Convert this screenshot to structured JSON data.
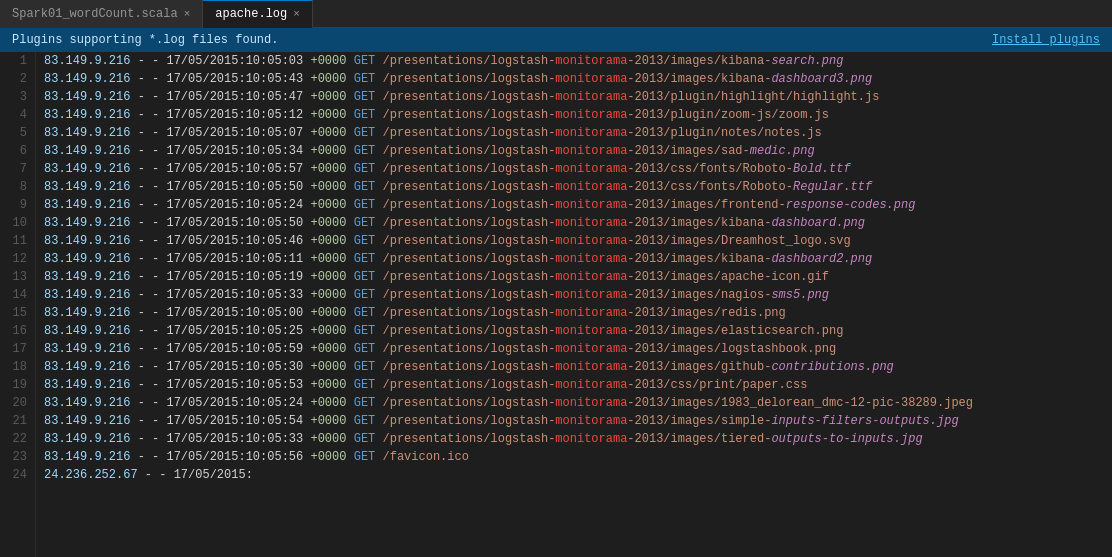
{
  "tabs": [
    {
      "id": "spark",
      "label": "Spark01_wordCount.scala",
      "active": false,
      "closeable": true
    },
    {
      "id": "apache",
      "label": "apache.log",
      "active": true,
      "closeable": true
    }
  ],
  "notification": {
    "message": "Plugins supporting *.log files found.",
    "install_label": "Install plugins"
  },
  "log_lines": [
    {
      "num": 1,
      "ip": "83.149.9.216",
      "dash": "- -",
      "datetime": "17/05/2015:10:05:03",
      "offset": "+0000",
      "method": "GET",
      "path": "/presentations/logstash-",
      "highlight": "monitorama",
      "path2": "-2013/images/kibana-",
      "italic": "search.png"
    },
    {
      "num": 2,
      "ip": "83.149.9.216",
      "dash": "- -",
      "datetime": "17/05/2015:10:05:43",
      "offset": "+0000",
      "method": "GET",
      "path": "/presentations/logstash-",
      "highlight": "monitorama",
      "path2": "-2013/images/kibana-",
      "italic": "dashboard3.png"
    },
    {
      "num": 3,
      "ip": "83.149.9.216",
      "dash": "- -",
      "datetime": "17/05/2015:10:05:47",
      "offset": "+0000",
      "method": "GET",
      "path": "/presentations/logstash-",
      "highlight": "monitorama",
      "path2": "-2013/plugin/highlight/highlight.js"
    },
    {
      "num": 4,
      "ip": "83.149.9.216",
      "dash": "- -",
      "datetime": "17/05/2015:10:05:12",
      "offset": "+0000",
      "method": "GET",
      "path": "/presentations/logstash-",
      "highlight": "monitorama",
      "path2": "-2013/plugin/zoom-js/zoom.js"
    },
    {
      "num": 5,
      "ip": "83.149.9.216",
      "dash": "- -",
      "datetime": "17/05/2015:10:05:07",
      "offset": "+0000",
      "method": "GET",
      "path": "/presentations/logstash-",
      "highlight": "monitorama",
      "path2": "-2013/plugin/notes/notes.js"
    },
    {
      "num": 6,
      "ip": "83.149.9.216",
      "dash": "- -",
      "datetime": "17/05/2015:10:05:34",
      "offset": "+0000",
      "method": "GET",
      "path": "/presentations/logstash-",
      "highlight": "monitorama",
      "path2": "-2013/images/sad-",
      "italic": "medic.png"
    },
    {
      "num": 7,
      "ip": "83.149.9.216",
      "dash": "- -",
      "datetime": "17/05/2015:10:05:57",
      "offset": "+0000",
      "method": "GET",
      "path": "/presentations/logstash-",
      "highlight": "monitorama",
      "path2": "-2013/css/fonts/Roboto-",
      "italic": "Bold.ttf"
    },
    {
      "num": 8,
      "ip": "83.149.9.216",
      "dash": "- -",
      "datetime": "17/05/2015:10:05:50",
      "offset": "+0000",
      "method": "GET",
      "path": "/presentations/logstash-",
      "highlight": "monitorama",
      "path2": "-2013/css/fonts/Roboto-",
      "italic": "Regular.ttf"
    },
    {
      "num": 9,
      "ip": "83.149.9.216",
      "dash": "- -",
      "datetime": "17/05/2015:10:05:24",
      "offset": "+0000",
      "method": "GET",
      "path": "/presentations/logstash-",
      "highlight": "monitorama",
      "path2": "-2013/images/frontend-",
      "italic": "response-codes.png"
    },
    {
      "num": 10,
      "ip": "83.149.9.216",
      "dash": "- -",
      "datetime": "17/05/2015:10:05:50",
      "offset": "+0000",
      "method": "GET",
      "path": "/presentations/logstash-",
      "highlight": "monitorama",
      "path2": "-2013/images/kibana-",
      "italic": "dashboard.png"
    },
    {
      "num": 11,
      "ip": "83.149.9.216",
      "dash": "- -",
      "datetime": "17/05/2015:10:05:46",
      "offset": "+0000",
      "method": "GET",
      "path": "/presentations/logstash-",
      "highlight": "monitorama",
      "path2": "-2013/images/Dreamhost_logo.svg"
    },
    {
      "num": 12,
      "ip": "83.149.9.216",
      "dash": "- -",
      "datetime": "17/05/2015:10:05:11",
      "offset": "+0000",
      "method": "GET",
      "path": "/presentations/logstash-",
      "highlight": "monitorama",
      "path2": "-2013/images/kibana-",
      "italic": "dashboard2.png"
    },
    {
      "num": 13,
      "ip": "83.149.9.216",
      "dash": "- -",
      "datetime": "17/05/2015:10:05:19",
      "offset": "+0000",
      "method": "GET",
      "path": "/presentations/logstash-",
      "highlight": "monitorama",
      "path2": "-2013/images/apache-icon.gif"
    },
    {
      "num": 14,
      "ip": "83.149.9.216",
      "dash": "- -",
      "datetime": "17/05/2015:10:05:33",
      "offset": "+0000",
      "method": "GET",
      "path": "/presentations/logstash-",
      "highlight": "monitorama",
      "path2": "-2013/images/nagios-",
      "italic": "sms5.png"
    },
    {
      "num": 15,
      "ip": "83.149.9.216",
      "dash": "- -",
      "datetime": "17/05/2015:10:05:00",
      "offset": "+0000",
      "method": "GET",
      "path": "/presentations/logstash-",
      "highlight": "monitorama",
      "path2": "-2013/images/redis.png"
    },
    {
      "num": 16,
      "ip": "83.149.9.216",
      "dash": "- -",
      "datetime": "17/05/2015:10:05:25",
      "offset": "+0000",
      "method": "GET",
      "path": "/presentations/logstash-",
      "highlight": "monitorama",
      "path2": "-2013/images/elasticsearch.png"
    },
    {
      "num": 17,
      "ip": "83.149.9.216",
      "dash": "- -",
      "datetime": "17/05/2015:10:05:59",
      "offset": "+0000",
      "method": "GET",
      "path": "/presentations/logstash-",
      "highlight": "monitorama",
      "path2": "-2013/images/logstashbook.png"
    },
    {
      "num": 18,
      "ip": "83.149.9.216",
      "dash": "- -",
      "datetime": "17/05/2015:10:05:30",
      "offset": "+0000",
      "method": "GET",
      "path": "/presentations/logstash-",
      "highlight": "monitorama",
      "path2": "-2013/images/github-",
      "italic": "contributions.png"
    },
    {
      "num": 19,
      "ip": "83.149.9.216",
      "dash": "- -",
      "datetime": "17/05/2015:10:05:53",
      "offset": "+0000",
      "method": "GET",
      "path": "/presentations/logstash-",
      "highlight": "monitorama",
      "path2": "-2013/css/print/paper.css"
    },
    {
      "num": 20,
      "ip": "83.149.9.216",
      "dash": "- -",
      "datetime": "17/05/2015:10:05:24",
      "offset": "+0000",
      "method": "GET",
      "path": "/presentations/logstash-",
      "highlight": "monitorama",
      "path2": "-2013/images/1983_delorean_dmc-12-pic-38289.jpeg"
    },
    {
      "num": 21,
      "ip": "83.149.9.216",
      "dash": "- -",
      "datetime": "17/05/2015:10:05:54",
      "offset": "+0000",
      "method": "GET",
      "path": "/presentations/logstash-",
      "highlight": "monitorama",
      "path2": "-2013/images/simple-",
      "italic": "inputs-filters-outputs.jpg"
    },
    {
      "num": 22,
      "ip": "83.149.9.216",
      "dash": "- -",
      "datetime": "17/05/2015:10:05:33",
      "offset": "+0000",
      "method": "GET",
      "path": "/presentations/logstash-",
      "highlight": "monitorama",
      "path2": "-2013/images/tiered-",
      "italic": "outputs-to-inputs.jpg"
    },
    {
      "num": 23,
      "ip": "83.149.9.216",
      "dash": "- -",
      "datetime": "17/05/2015:10:05:56",
      "offset": "+0000",
      "method": "GET",
      "path": "/favicon.ico",
      "highlight": "",
      "path2": "",
      "italic": ""
    },
    {
      "num": 24,
      "ip": "24.236.252.67",
      "dash": "- -",
      "datetime": "17/05/2015:",
      "offset": "",
      "method": "",
      "path": "",
      "highlight": "",
      "path2": "",
      "italic": ""
    }
  ]
}
